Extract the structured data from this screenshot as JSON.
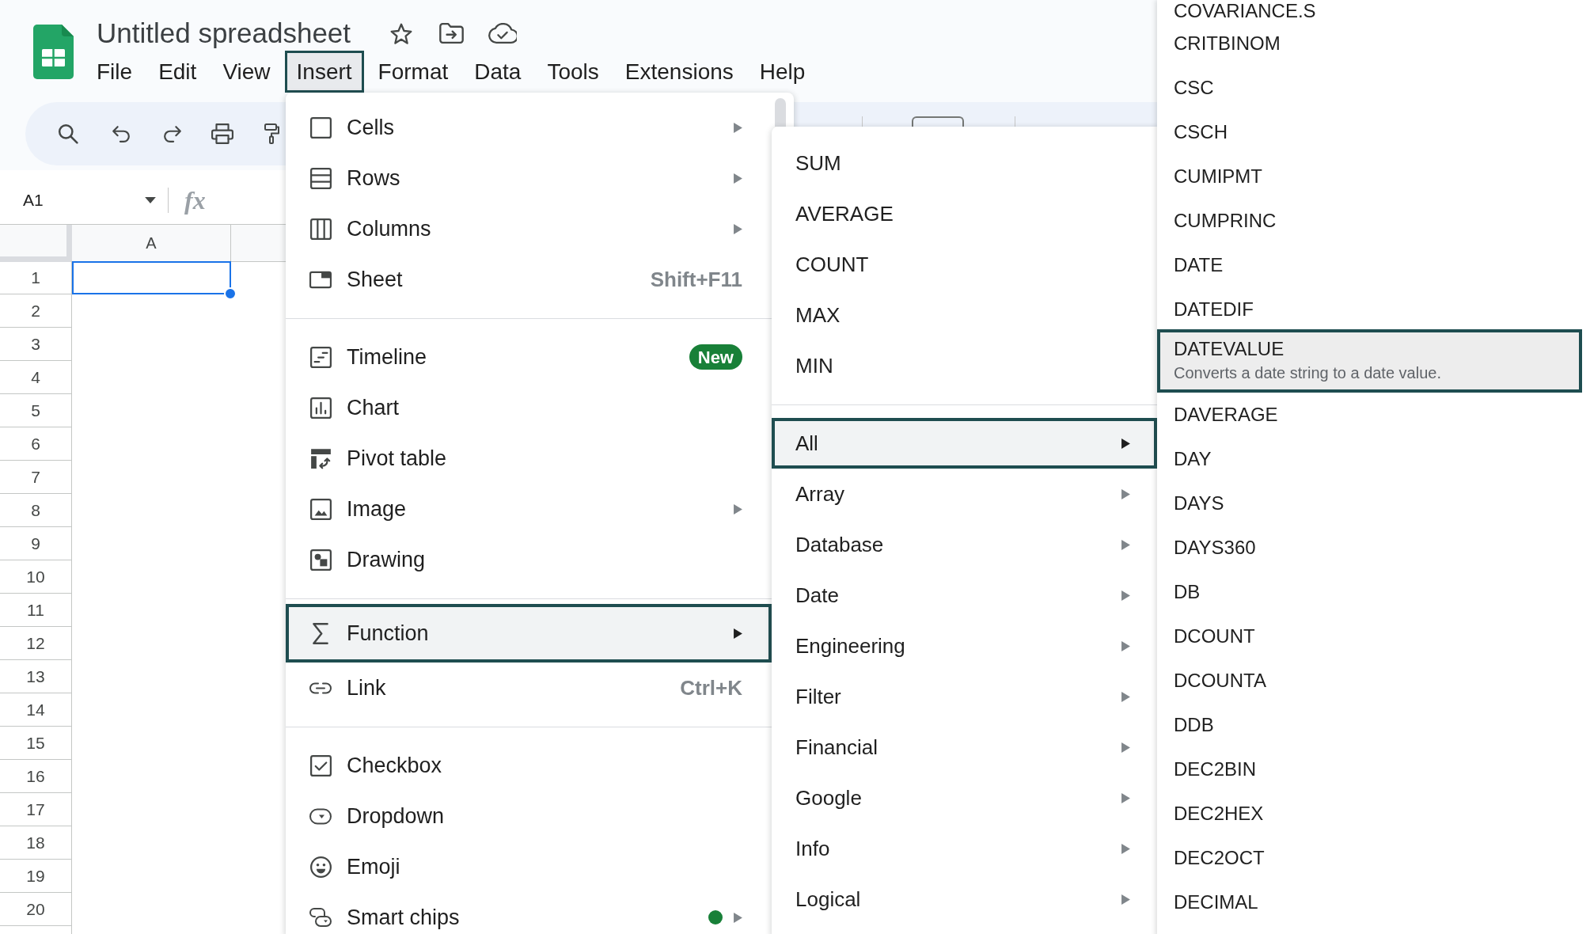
{
  "document": {
    "title": "Untitled spreadsheet"
  },
  "menubar": [
    {
      "label": "File",
      "selected": false
    },
    {
      "label": "Edit",
      "selected": false
    },
    {
      "label": "View",
      "selected": false
    },
    {
      "label": "Insert",
      "selected": true
    },
    {
      "label": "Format",
      "selected": false
    },
    {
      "label": "Data",
      "selected": false
    },
    {
      "label": "Tools",
      "selected": false
    },
    {
      "label": "Extensions",
      "selected": false
    },
    {
      "label": "Help",
      "selected": false
    }
  ],
  "formula_bar": {
    "name_box": "A1",
    "fx": "fx"
  },
  "sheet": {
    "columns": [
      {
        "label": "A"
      }
    ],
    "rows": [
      {
        "label": "1",
        "selected": true
      },
      {
        "label": "2",
        "selected": false
      },
      {
        "label": "3",
        "selected": false
      },
      {
        "label": "4",
        "selected": false
      },
      {
        "label": "5",
        "selected": false
      },
      {
        "label": "6",
        "selected": false
      },
      {
        "label": "7",
        "selected": false
      },
      {
        "label": "8",
        "selected": false
      },
      {
        "label": "9",
        "selected": false
      },
      {
        "label": "10",
        "selected": false
      },
      {
        "label": "11",
        "selected": false
      },
      {
        "label": "12",
        "selected": false
      },
      {
        "label": "13",
        "selected": false
      },
      {
        "label": "14",
        "selected": false
      },
      {
        "label": "15",
        "selected": false
      },
      {
        "label": "16",
        "selected": false
      },
      {
        "label": "17",
        "selected": false
      },
      {
        "label": "18",
        "selected": false
      },
      {
        "label": "19",
        "selected": false
      },
      {
        "label": "20",
        "selected": false
      }
    ]
  },
  "insert_menu": {
    "groups": [
      {
        "items": [
          {
            "label": "Cells",
            "submenu": true,
            "dot": false,
            "selected": false
          },
          {
            "label": "Rows",
            "submenu": true,
            "dot": false,
            "selected": false
          },
          {
            "label": "Columns",
            "submenu": true,
            "dot": false,
            "selected": false
          },
          {
            "label": "Sheet",
            "shortcut": "Shift+F11",
            "submenu": false,
            "dot": false,
            "selected": false
          }
        ]
      },
      {
        "items": [
          {
            "label": "Timeline",
            "badge": "New",
            "submenu": false,
            "dot": false,
            "selected": false
          },
          {
            "label": "Chart",
            "submenu": false,
            "dot": false,
            "selected": false
          },
          {
            "label": "Pivot table",
            "submenu": false,
            "dot": false,
            "selected": false
          },
          {
            "label": "Image",
            "submenu": true,
            "dot": false,
            "selected": false
          },
          {
            "label": "Drawing",
            "submenu": false,
            "dot": false,
            "selected": false
          }
        ]
      },
      {
        "items": [
          {
            "label": "Function",
            "submenu": true,
            "dot": false,
            "selected": true
          },
          {
            "label": "Link",
            "shortcut": "Ctrl+K",
            "submenu": false,
            "dot": false,
            "selected": false
          }
        ]
      },
      {
        "items": [
          {
            "label": "Checkbox",
            "submenu": false,
            "dot": false,
            "selected": false
          },
          {
            "label": "Dropdown",
            "submenu": false,
            "dot": false,
            "selected": false
          },
          {
            "label": "Emoji",
            "submenu": false,
            "dot": false,
            "selected": false
          },
          {
            "label": "Smart chips",
            "submenu": true,
            "dot": true,
            "selected": false
          }
        ]
      }
    ]
  },
  "function_menu": {
    "groups": [
      {
        "items": [
          {
            "label": "SUM",
            "submenu": false,
            "selected": false
          },
          {
            "label": "AVERAGE",
            "submenu": false,
            "selected": false
          },
          {
            "label": "COUNT",
            "submenu": false,
            "selected": false
          },
          {
            "label": "MAX",
            "submenu": false,
            "selected": false
          },
          {
            "label": "MIN",
            "submenu": false,
            "selected": false
          }
        ]
      },
      {
        "items": [
          {
            "label": "All",
            "submenu": true,
            "selected": true
          },
          {
            "label": "Array",
            "submenu": true,
            "selected": false
          },
          {
            "label": "Database",
            "submenu": true,
            "selected": false
          },
          {
            "label": "Date",
            "submenu": true,
            "selected": false
          },
          {
            "label": "Engineering",
            "submenu": true,
            "selected": false
          },
          {
            "label": "Filter",
            "submenu": true,
            "selected": false
          },
          {
            "label": "Financial",
            "submenu": true,
            "selected": false
          },
          {
            "label": "Google",
            "submenu": true,
            "selected": false
          },
          {
            "label": "Info",
            "submenu": true,
            "selected": false
          },
          {
            "label": "Logical",
            "submenu": true,
            "selected": false
          }
        ]
      }
    ]
  },
  "all_functions_menu": {
    "items": [
      {
        "label": "COVARIANCE.S",
        "selected": false
      },
      {
        "label": "CRITBINOM",
        "selected": false
      },
      {
        "label": "CSC",
        "selected": false
      },
      {
        "label": "CSCH",
        "selected": false
      },
      {
        "label": "CUMIPMT",
        "selected": false
      },
      {
        "label": "CUMPRINC",
        "selected": false
      },
      {
        "label": "DATE",
        "selected": false
      },
      {
        "label": "DATEDIF",
        "selected": false
      },
      {
        "label": "DATEVALUE",
        "description": "Converts a date string to a date value.",
        "selected": true
      },
      {
        "label": "DAVERAGE",
        "selected": false
      },
      {
        "label": "DAY",
        "selected": false
      },
      {
        "label": "DAYS",
        "selected": false
      },
      {
        "label": "DAYS360",
        "selected": false
      },
      {
        "label": "DB",
        "selected": false
      },
      {
        "label": "DCOUNT",
        "selected": false
      },
      {
        "label": "DCOUNTA",
        "selected": false
      },
      {
        "label": "DDB",
        "selected": false
      },
      {
        "label": "DEC2BIN",
        "selected": false
      },
      {
        "label": "DEC2HEX",
        "selected": false
      },
      {
        "label": "DEC2OCT",
        "selected": false
      },
      {
        "label": "DECIMAL",
        "selected": false
      }
    ]
  }
}
